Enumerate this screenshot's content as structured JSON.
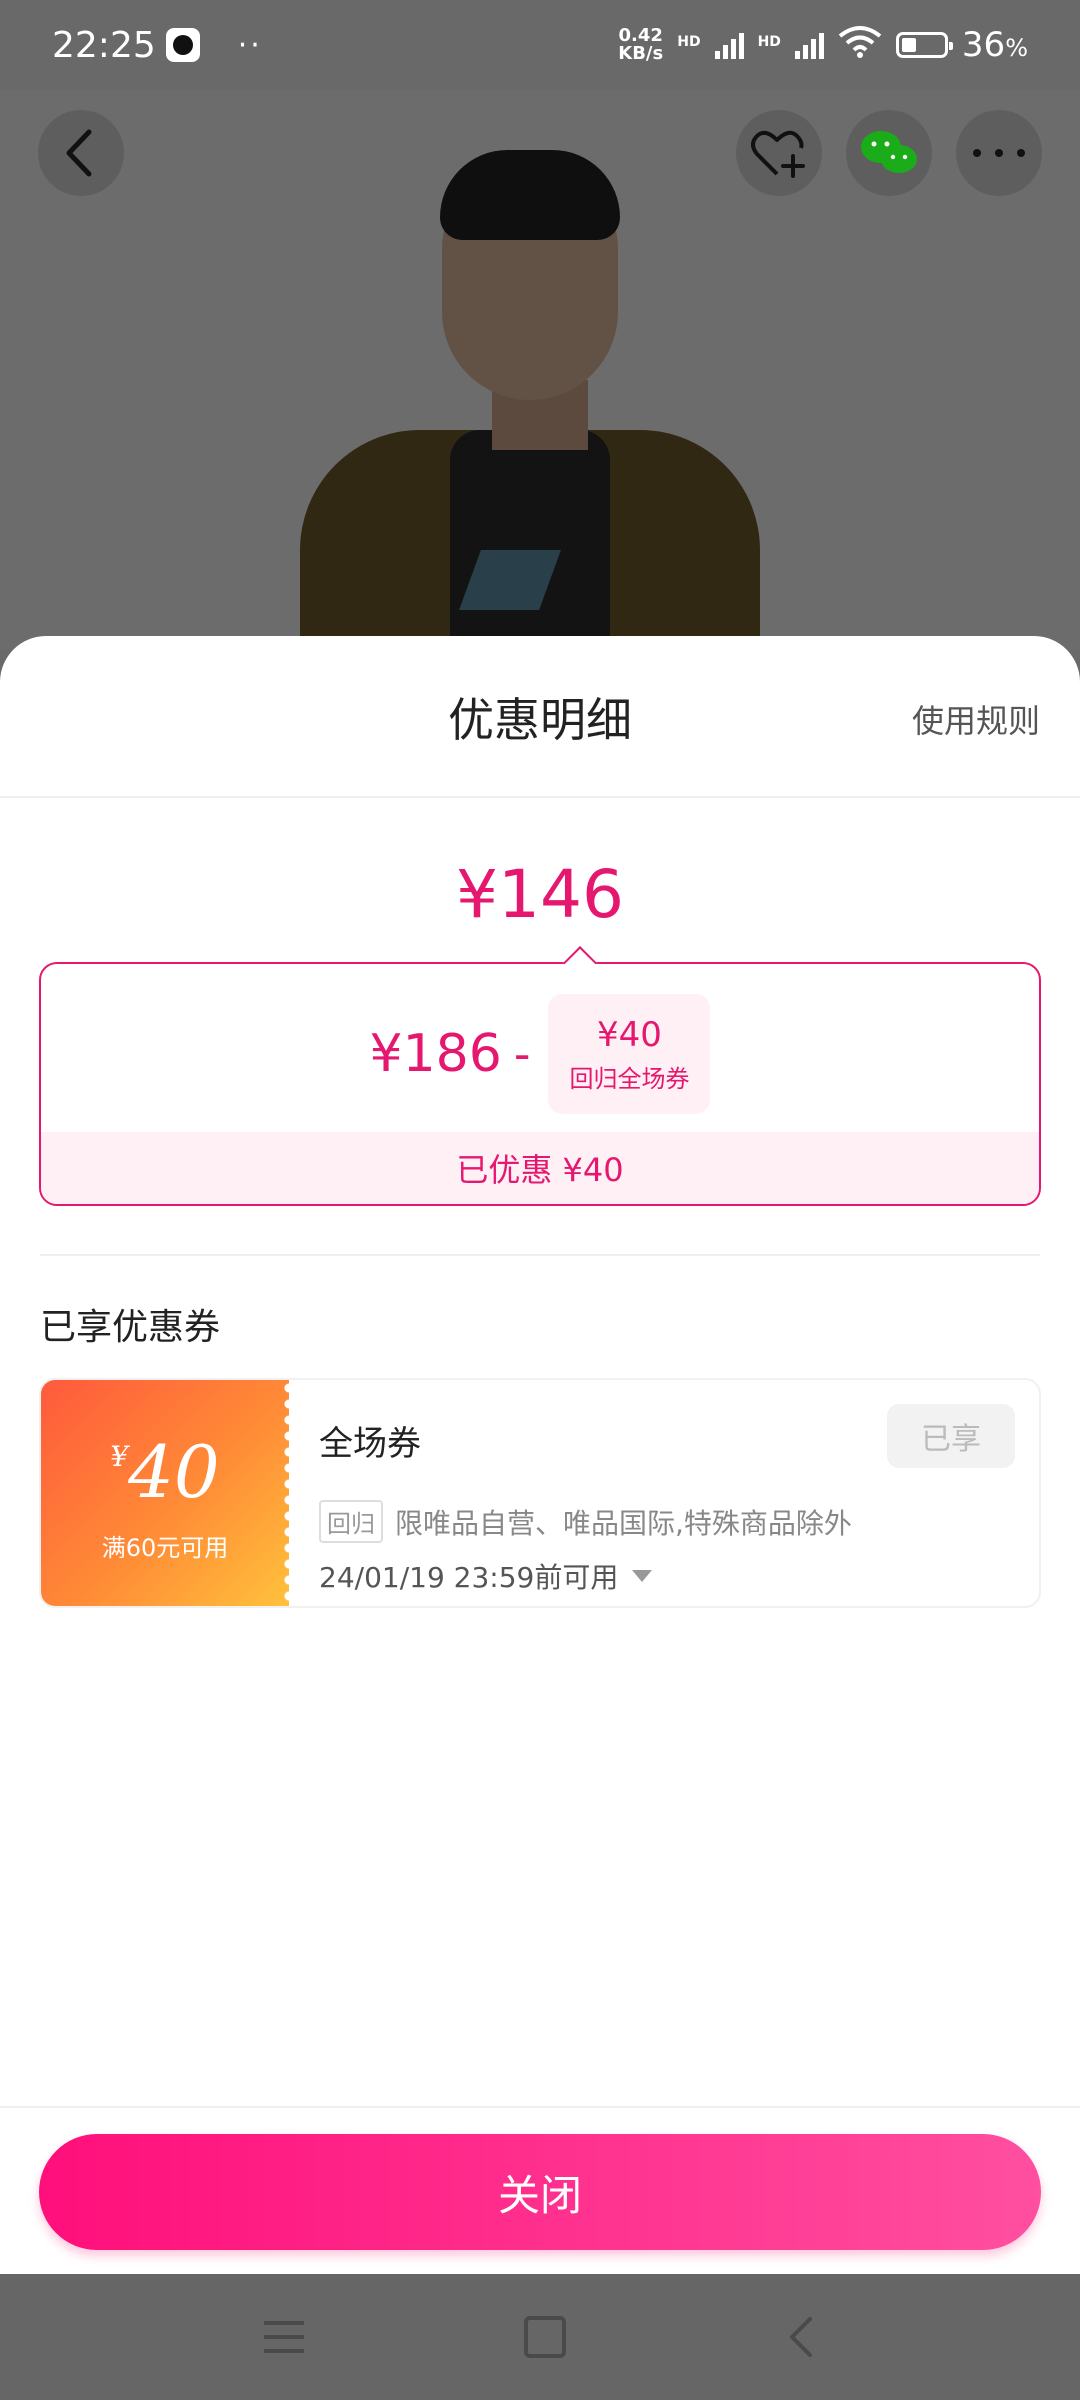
{
  "status_bar": {
    "time": "22:25",
    "dots": "··",
    "net_speed_value": "0.42",
    "net_speed_unit": "KB/s",
    "signal_labels": [
      "HD",
      "HD"
    ],
    "battery_level": 0.36,
    "battery_percent": "36",
    "battery_percent_unit": "%"
  },
  "top_nav": {
    "icons": [
      "back-icon",
      "favorite-add-icon",
      "wechat-icon",
      "more-icon"
    ]
  },
  "sheet": {
    "title": "优惠明细",
    "rules_link": "使用规则",
    "final_price": "¥146",
    "original_price": "¥186",
    "minus_sign": "-",
    "discount_chip": {
      "amount": "¥40",
      "name": "回归全场券"
    },
    "saved_text": "已优惠 ¥40",
    "section_title": "已享优惠券",
    "coupon": {
      "yen_symbol": "¥",
      "amount": "40",
      "condition": "满60元可用",
      "name": "全场券",
      "status": "已享",
      "tag": "回归",
      "scope": "限唯品自营、唯品国际,特殊商品除外",
      "expiry": "24/01/19 23:59前可用",
      "accent_gradient": [
        "#ff5a3c",
        "#ffc23c"
      ]
    },
    "close_button": "关闭"
  },
  "colors": {
    "accent": "#e5176f",
    "button_start": "#ff0f7b",
    "button_end": "#ff4fa0"
  },
  "navbar": {
    "icons": [
      "menu-icon",
      "home-icon",
      "back-nav-icon"
    ]
  }
}
